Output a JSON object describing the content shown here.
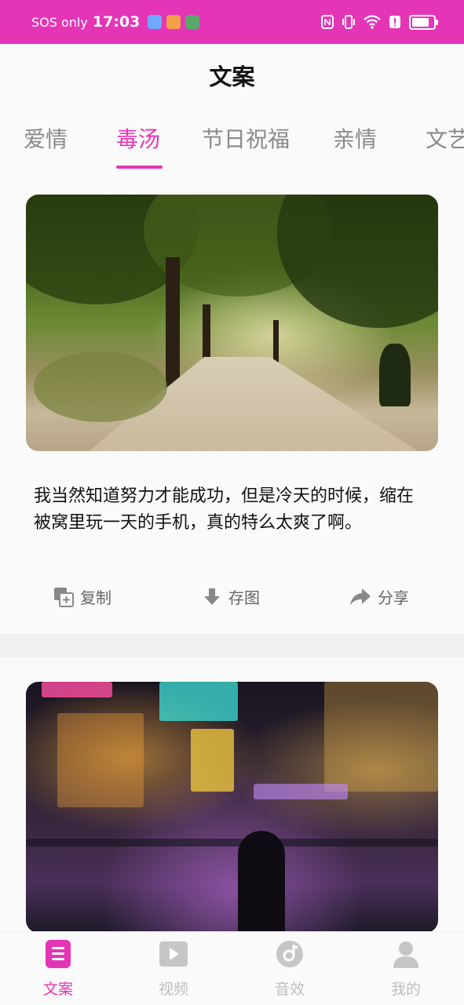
{
  "status_bar": {
    "carrier": "SOS only",
    "time": "17:03"
  },
  "header": {
    "title": "文案"
  },
  "tabs": [
    {
      "label": "爱情",
      "active": false
    },
    {
      "label": "毒汤",
      "active": true
    },
    {
      "label": "节日祝福",
      "active": false
    },
    {
      "label": "亲情",
      "active": false
    },
    {
      "label": "文艺",
      "active": false
    }
  ],
  "posts": [
    {
      "image": "park-path-trees",
      "text": "我当然知道努力才能成功，但是冷天的时候，缩在被窝里玩一天的手机，真的特么太爽了啊。",
      "actions": {
        "copy": "复制",
        "save": "存图",
        "share": "分享"
      }
    },
    {
      "image": "city-night-street"
    }
  ],
  "bottom_nav": [
    {
      "label": "文案",
      "icon": "document-icon",
      "active": true
    },
    {
      "label": "视频",
      "icon": "video-icon",
      "active": false
    },
    {
      "label": "音效",
      "icon": "music-icon",
      "active": false
    },
    {
      "label": "我的",
      "icon": "user-icon",
      "active": false
    }
  ],
  "colors": {
    "accent": "#e535b7",
    "inactive": "#bdbdbd"
  }
}
